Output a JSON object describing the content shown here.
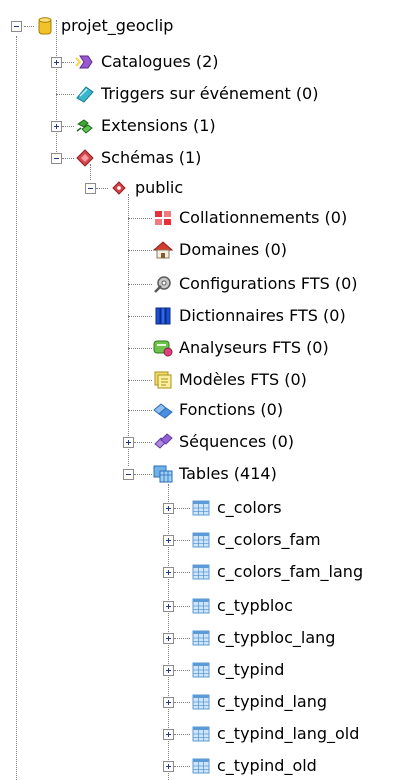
{
  "tree": {
    "root": {
      "label": "projet_geoclip",
      "icon": "database-icon"
    },
    "nodes": [
      {
        "label": "Catalogues (2)",
        "icon": "catalog-icon",
        "expander": "plus"
      },
      {
        "label": "Triggers sur événement (0)",
        "icon": "event-trigger-icon",
        "expander": "none"
      },
      {
        "label": "Extensions (1)",
        "icon": "extension-icon",
        "expander": "plus"
      },
      {
        "label": "Schémas (1)",
        "icon": "schema-icon",
        "expander": "minus"
      }
    ],
    "schema": {
      "label": "public",
      "icon": "schema-public-icon",
      "expander": "minus"
    },
    "schema_children": [
      {
        "label": "Collationnements (0)",
        "icon": "collation-icon",
        "expander": "none"
      },
      {
        "label": "Domaines (0)",
        "icon": "domain-icon",
        "expander": "none"
      },
      {
        "label": "Configurations FTS (0)",
        "icon": "fts-config-icon",
        "expander": "none"
      },
      {
        "label": "Dictionnaires FTS (0)",
        "icon": "fts-dictionary-icon",
        "expander": "none"
      },
      {
        "label": "Analyseurs FTS (0)",
        "icon": "fts-parser-icon",
        "expander": "none"
      },
      {
        "label": "Modèles FTS (0)",
        "icon": "fts-template-icon",
        "expander": "none"
      },
      {
        "label": "Fonctions (0)",
        "icon": "function-icon",
        "expander": "none"
      },
      {
        "label": "Séquences (0)",
        "icon": "sequence-icon",
        "expander": "plus"
      },
      {
        "label": "Tables (414)",
        "icon": "tables-icon",
        "expander": "minus"
      }
    ],
    "tables": [
      {
        "label": "c_colors",
        "icon": "table-icon"
      },
      {
        "label": "c_colors_fam",
        "icon": "table-icon"
      },
      {
        "label": "c_colors_fam_lang",
        "icon": "table-icon"
      },
      {
        "label": "c_typbloc",
        "icon": "table-icon"
      },
      {
        "label": "c_typbloc_lang",
        "icon": "table-icon"
      },
      {
        "label": "c_typind",
        "icon": "table-icon"
      },
      {
        "label": "c_typind_lang",
        "icon": "table-icon"
      },
      {
        "label": "c_typind_lang_old",
        "icon": "table-icon"
      },
      {
        "label": "c_typind_old",
        "icon": "table-icon"
      }
    ]
  }
}
